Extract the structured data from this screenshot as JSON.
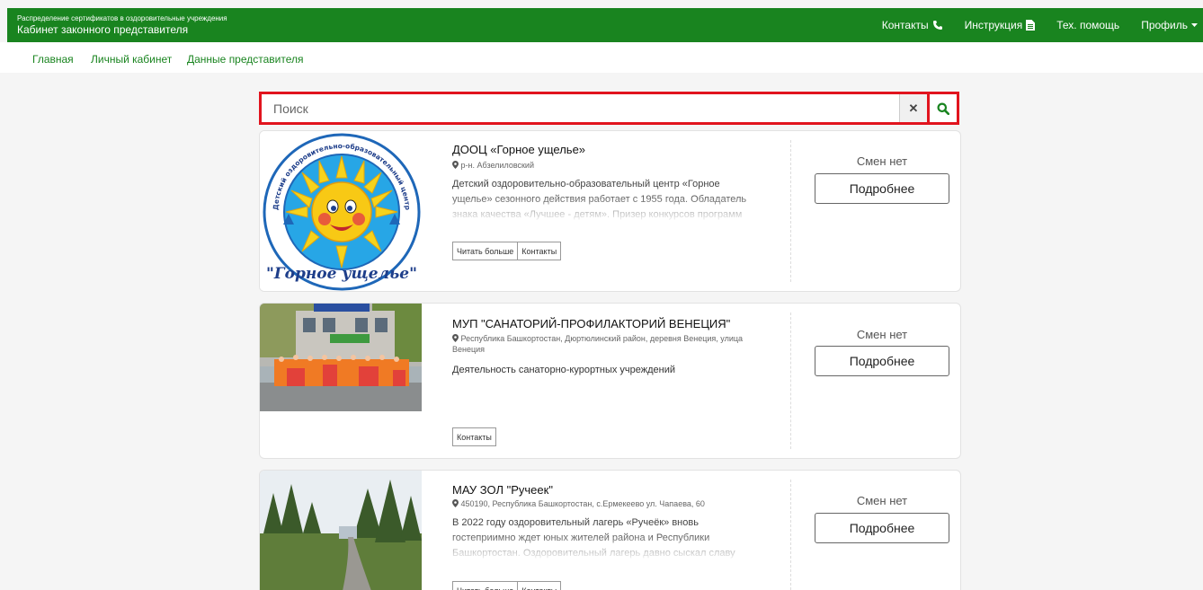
{
  "header": {
    "subtitle": "Распределение сертификатов в оздоровительные учреждения",
    "title": "Кабинет законного представителя",
    "nav": [
      {
        "label": "Контакты",
        "icon": "phone-icon"
      },
      {
        "label": "Инструкция",
        "icon": "document-icon"
      },
      {
        "label": "Тех. помощь"
      },
      {
        "label": "Профиль",
        "icon": "caret-down-icon"
      }
    ]
  },
  "subnav": [
    "Главная",
    "Личный кабинет",
    "Данные представителя"
  ],
  "search": {
    "placeholder": "Поиск",
    "clear_symbol": "✕"
  },
  "colors": {
    "brand": "#19841f",
    "highlight": "#e1141e",
    "search_icon": "#19841f"
  },
  "cards": [
    {
      "title": "ДООЦ «Горное ущелье»",
      "address": "р-н. Абзелиловский",
      "description": "Детский оздоровительно-образовательный центр «Горное ущелье» сезонного действия работает с 1955 года. Обладатель знака качества «Лучшее - детям». Призер конкурсов программ",
      "status": "Смен нет",
      "more": "Подробнее",
      "read_more": "Читать больше",
      "contacts": "Контакты",
      "logo_text": "\"Горное ущелье\"",
      "logo_ring_text": "Детский оздоровительно-образовательный центр"
    },
    {
      "title": "МУП \"САНАТОРИЙ-ПРОФИЛАКТОРИЙ ВЕНЕЦИЯ\"",
      "address": "Республика Башкортостан, Дюртюлинский район, деревня Венеция, улица Венеция",
      "description": "Деятельность санаторно-курортных учреждений",
      "status": "Смен нет",
      "more": "Подробнее",
      "contacts": "Контакты"
    },
    {
      "title": "МАУ ЗОЛ \"Ручеек\"",
      "address": "450190, Республика Башкортостан, с.Ермекеево ул. Чапаева, 60",
      "description": "В 2022 году оздоровительный лагерь «Ручеёк» вновь гостеприимно ждет юных жителей района и Республики Башкортостан. Оздоровительный лагерь давно сыскал славу",
      "status": "Смен нет",
      "more": "Подробнее",
      "read_more": "Читать больше",
      "contacts": "Контакты"
    }
  ]
}
